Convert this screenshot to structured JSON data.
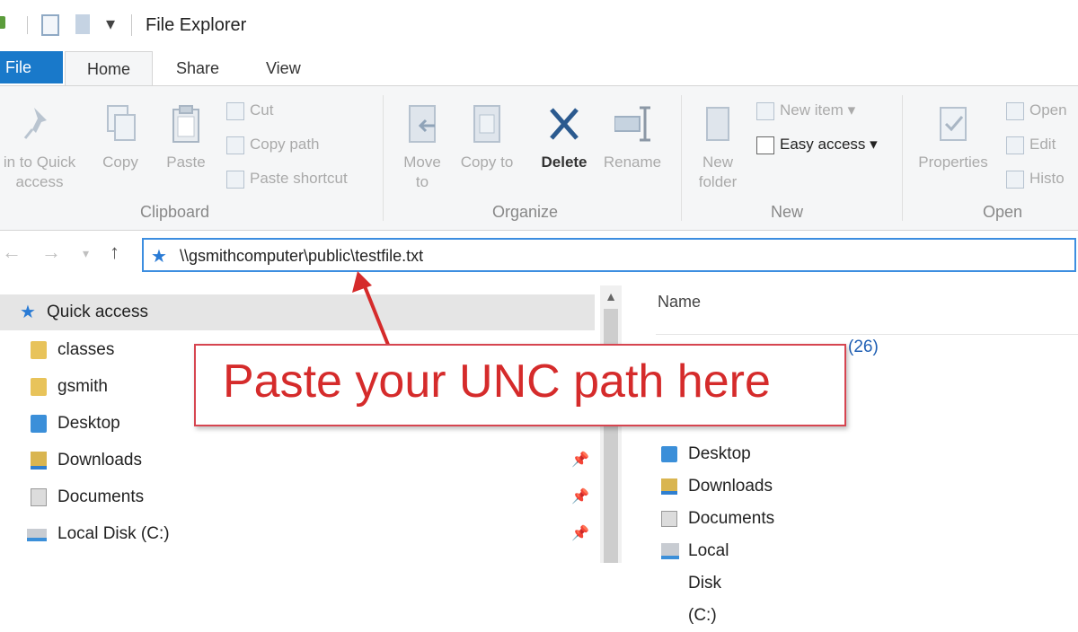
{
  "window": {
    "title": "File Explorer"
  },
  "ribbon_tabs": {
    "file": "File",
    "home": "Home",
    "share": "Share",
    "view": "View"
  },
  "clipboard": {
    "pin": "in to Quick access",
    "copy": "Copy",
    "paste": "Paste",
    "cut": "Cut",
    "copy_path": "Copy path",
    "paste_shortcut": "Paste shortcut",
    "label": "Clipboard"
  },
  "organize": {
    "move_to": "Move to",
    "copy_to": "Copy to",
    "delete": "Delete",
    "rename": "Rename",
    "label": "Organize"
  },
  "new": {
    "new_folder": "New folder",
    "new_item": "New item",
    "easy_access": "Easy access",
    "label": "New"
  },
  "open": {
    "properties": "Properties",
    "open": "Open",
    "edit": "Edit",
    "history": "Histo",
    "label": "Open"
  },
  "address": {
    "value": "\\\\gsmithcomputer\\public\\testfile.txt"
  },
  "navpane": {
    "quick_access": "Quick access",
    "items": [
      {
        "label": "classes"
      },
      {
        "label": "gsmith"
      },
      {
        "label": "Desktop"
      },
      {
        "label": "Downloads"
      },
      {
        "label": "Documents"
      },
      {
        "label": "Local Disk (C:)"
      }
    ]
  },
  "content": {
    "column_name": "Name",
    "frequent_suffix": "(26)",
    "items": [
      {
        "label": "Desktop"
      },
      {
        "label": "Downloads"
      },
      {
        "label": "Documents"
      },
      {
        "label": "Local Disk (C:)"
      }
    ]
  },
  "callout": {
    "text": "Paste your UNC path here"
  },
  "colors": {
    "accent": "#1979ca",
    "callout_red": "#d52b2b",
    "address_border": "#3d8ee0"
  }
}
